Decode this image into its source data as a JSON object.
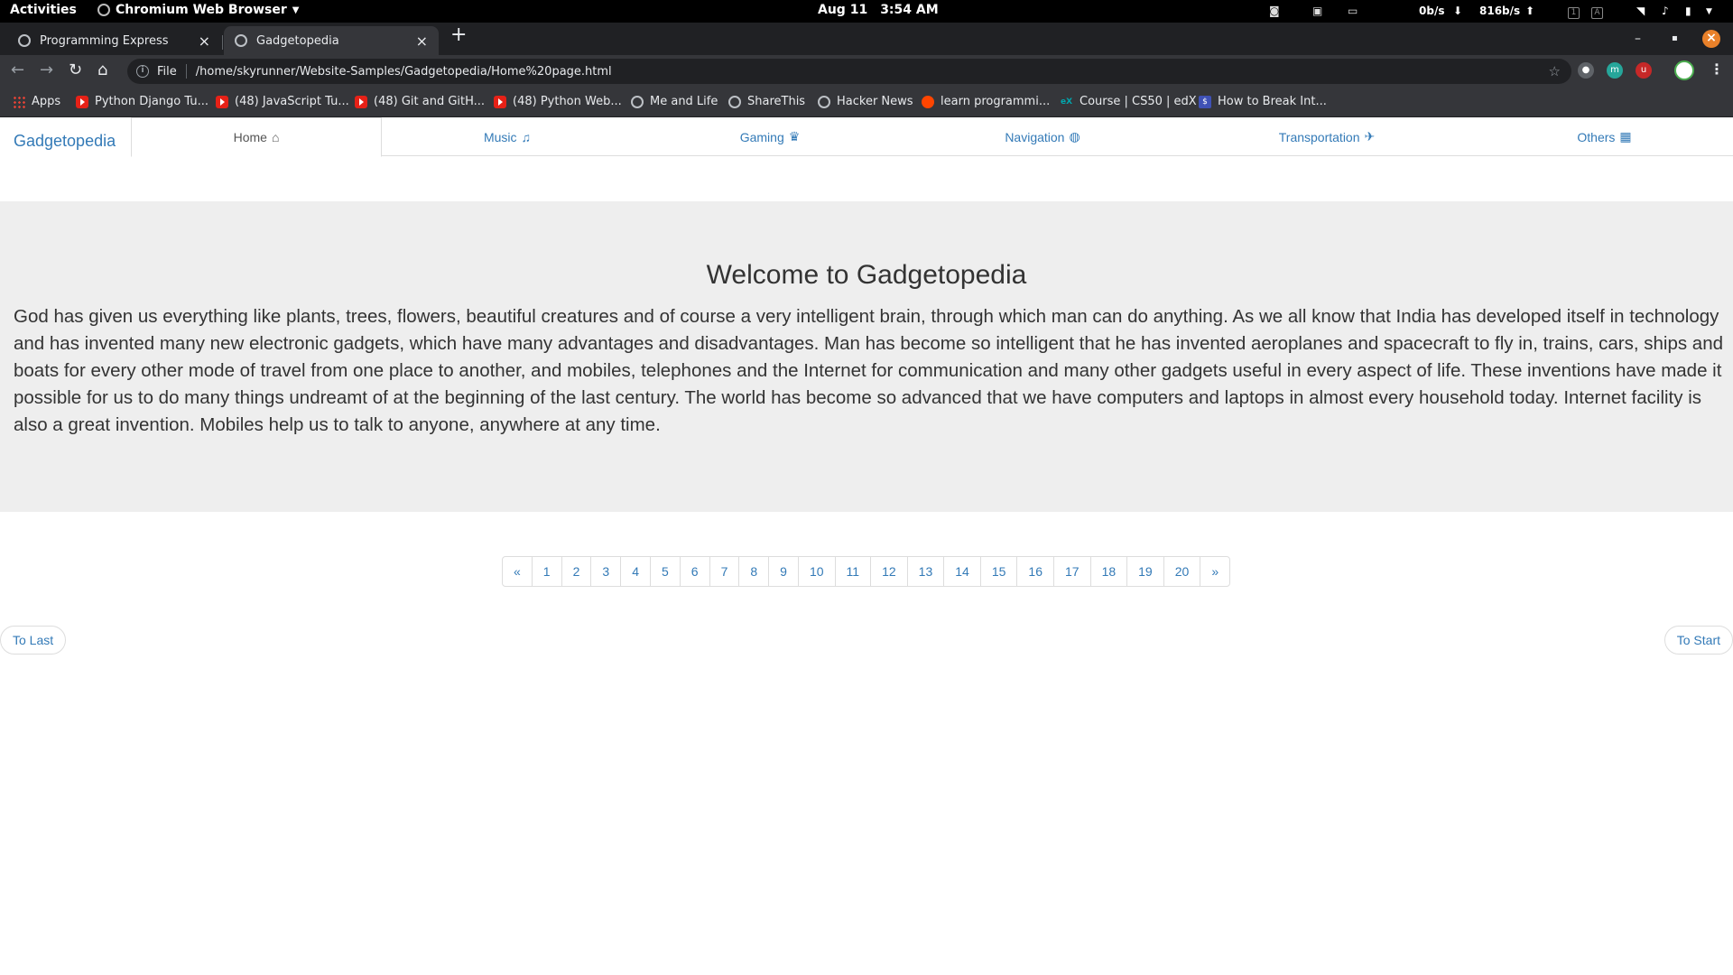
{
  "system_bar": {
    "activities": "Activities",
    "app_name": "Chromium Web Browser",
    "date": "Aug 11",
    "time": "3:54 AM",
    "net_down": "0b/s",
    "net_up": "816b/s"
  },
  "browser": {
    "tabs": [
      {
        "title": "Programming Express",
        "active": false
      },
      {
        "title": "Gadgetopedia",
        "active": true
      }
    ],
    "address": {
      "scheme_label": "File",
      "url": "/home/skyrunner/Website-Samples/Gadgetopedia/Home%20page.html"
    },
    "bookmarks": [
      {
        "label": "Apps",
        "icon": "apps-grid-icon"
      },
      {
        "label": "Python Django Tu...",
        "icon": "youtube-icon"
      },
      {
        "label": "(48) JavaScript Tu...",
        "icon": "youtube-icon"
      },
      {
        "label": "(48) Git and GitH...",
        "icon": "youtube-icon"
      },
      {
        "label": "(48) Python Web...",
        "icon": "youtube-icon"
      },
      {
        "label": "Me and Life",
        "icon": "globe-icon"
      },
      {
        "label": "ShareThis",
        "icon": "globe-icon"
      },
      {
        "label": "Hacker News",
        "icon": "globe-icon"
      },
      {
        "label": "learn programmi...",
        "icon": "reddit-icon"
      },
      {
        "label": "Course | CS50 | edX",
        "icon": "edx-icon"
      },
      {
        "label": "How to Break Int...",
        "icon": "terminal-dollar-icon"
      }
    ]
  },
  "site": {
    "brand": "Gadgetopedia",
    "nav": [
      {
        "label": "Home",
        "icon": "home-icon",
        "glyph": "⌂",
        "active": true
      },
      {
        "label": "Music",
        "icon": "headphones-icon",
        "glyph": "♫",
        "active": false
      },
      {
        "label": "Gaming",
        "icon": "chess-queen-icon",
        "glyph": "♛",
        "active": false
      },
      {
        "label": "Navigation",
        "icon": "globe-icon",
        "glyph": "◍",
        "active": false
      },
      {
        "label": "Transportation",
        "icon": "plane-icon",
        "glyph": "✈",
        "active": false
      },
      {
        "label": "Others",
        "icon": "grid-icon",
        "glyph": "▦",
        "active": false
      }
    ],
    "hero": {
      "heading": "Welcome to Gadgetopedia",
      "body": "God has given us everything like plants, trees, flowers, beautiful creatures and of course a very intelligent brain, through which man can do anything. As we all know that India has developed itself in technology and has invented many new electronic gadgets, which have many advantages and disadvantages. Man has become so intelligent that he has invented aeroplanes and spacecraft to fly in, trains, cars, ships and boats for every other mode of travel from one place to another, and mobiles, telephones and the Internet for communication and many other gadgets useful in every aspect of life. These inventions have made it possible for us to do many things undreamt of at the beginning of the last century. The world has become so advanced that we have computers and laptops in almost every household today. Internet facility is also a great invention. Mobiles help us to talk to anyone, anywhere at any time."
    },
    "pagination": [
      "«",
      "1",
      "2",
      "3",
      "4",
      "5",
      "6",
      "7",
      "8",
      "9",
      "10",
      "11",
      "12",
      "13",
      "14",
      "15",
      "16",
      "17",
      "18",
      "19",
      "20",
      "»"
    ],
    "to_last": "To Last",
    "to_start": "To Start"
  },
  "colors": {
    "link": "#337ab7",
    "jumbotron_bg": "#eeeeee",
    "chrome_dark": "#35363a"
  }
}
